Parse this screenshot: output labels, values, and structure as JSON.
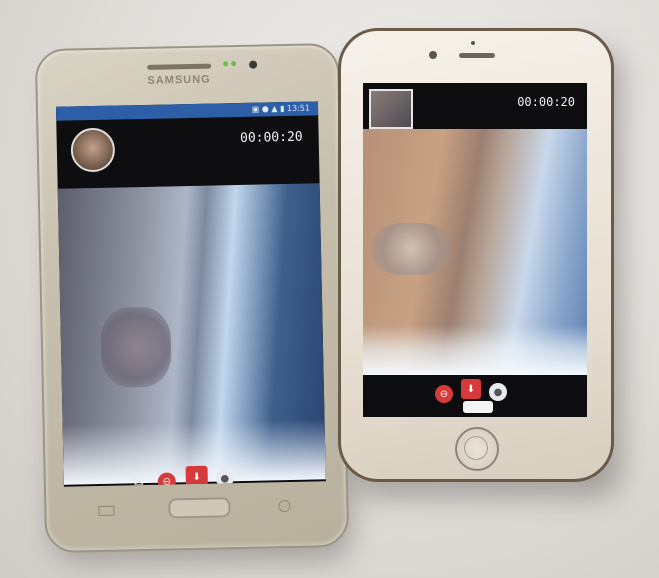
{
  "image": {
    "samsung_phone": {
      "brand_text": "SAMSUNG",
      "call_timer": "00:00:20",
      "status_bar_color": "#2d5fa8",
      "status_icons": "▣ ● ▲ ▮ 13:51",
      "controls": [
        {
          "icon": "chat-icon",
          "glyph": "✉"
        },
        {
          "icon": "mute-icon",
          "glyph": "⊖"
        },
        {
          "icon": "camera-switch-icon",
          "glyph": "⬇"
        },
        {
          "icon": "bulb-icon",
          "glyph": "●"
        }
      ]
    },
    "iphone": {
      "call_timer": "00:00:20",
      "controls": [
        {
          "icon": "mute-icon",
          "glyph": "⊖"
        },
        {
          "icon": "camera-switch-icon",
          "glyph": "⬇"
        },
        {
          "icon": "bulb-icon",
          "glyph": "●"
        }
      ]
    },
    "colors": {
      "accent_red": "#d63a3a",
      "phone_gold": "#c7bfad",
      "iphone_white": "#f6f1ea"
    }
  }
}
